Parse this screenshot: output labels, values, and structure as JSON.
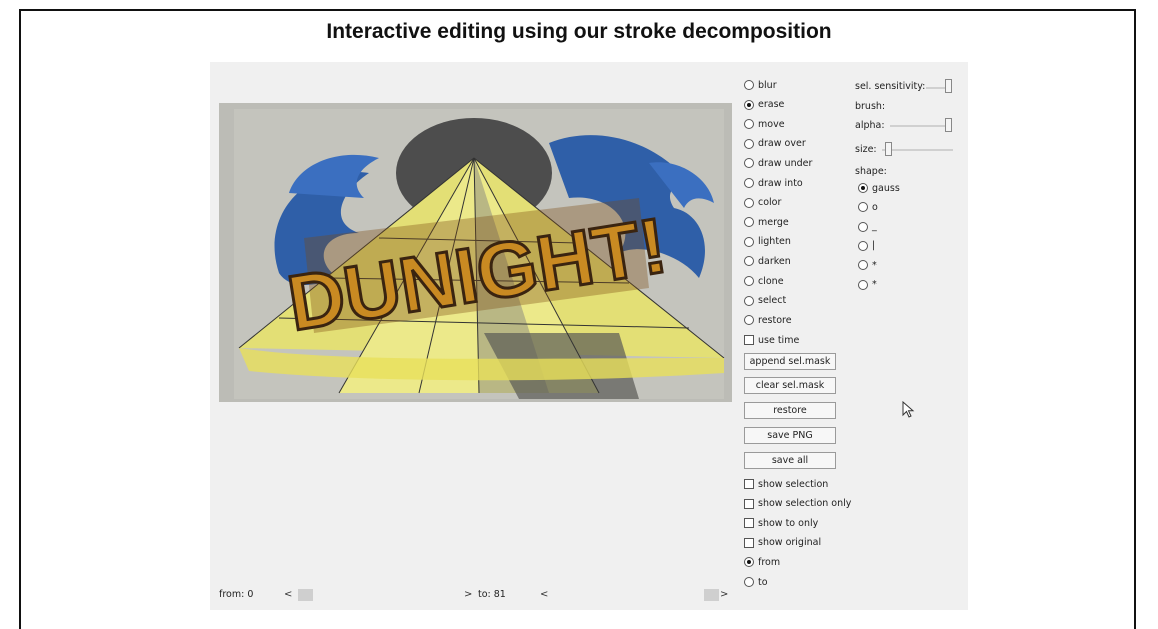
{
  "title": "Interactive editing using our stroke decomposition",
  "canvas": {
    "artwork_text": "DUNIGHT!"
  },
  "tools": [
    {
      "label": "blur",
      "selected": false
    },
    {
      "label": "erase",
      "selected": true
    },
    {
      "label": "move",
      "selected": false
    },
    {
      "label": "draw over",
      "selected": false
    },
    {
      "label": "draw under",
      "selected": false
    },
    {
      "label": "draw into",
      "selected": false
    },
    {
      "label": "color",
      "selected": false
    },
    {
      "label": "merge",
      "selected": false
    },
    {
      "label": "lighten",
      "selected": false
    },
    {
      "label": "darken",
      "selected": false
    },
    {
      "label": "clone",
      "selected": false
    },
    {
      "label": "select",
      "selected": false
    },
    {
      "label": "restore",
      "selected": false
    }
  ],
  "use_time": {
    "label": "use time",
    "checked": false
  },
  "buttons": {
    "append": "append sel.mask",
    "clear": "clear sel.mask",
    "restore": "restore",
    "save_png": "save PNG",
    "save_all": "save all"
  },
  "checks": [
    {
      "label": "show selection",
      "checked": false
    },
    {
      "label": "show selection only",
      "checked": false
    },
    {
      "label": "show to only",
      "checked": false
    },
    {
      "label": "show original",
      "checked": false
    }
  ],
  "range_mode": [
    {
      "label": "from",
      "selected": true
    },
    {
      "label": "to",
      "selected": false
    }
  ],
  "settings": {
    "sensitivity_label": "sel. sensitivity:",
    "sensitivity_value": 1.0,
    "brush_label": "brush:",
    "alpha_label": "alpha:",
    "alpha_value": 1.0,
    "size_label": "size:",
    "size_value": 0.05,
    "shape_label": "shape:",
    "shapes": [
      {
        "label": "gauss",
        "selected": true
      },
      {
        "label": "o",
        "selected": false
      },
      {
        "label": "_",
        "selected": false
      },
      {
        "label": "|",
        "selected": false
      },
      {
        "label": "*",
        "selected": false
      },
      {
        "label": "*",
        "selected": false
      }
    ]
  },
  "timeline": {
    "from_label": "from: 0",
    "to_label": "to: 81",
    "left_arrow": "<",
    "right_arrow": ">",
    "from_value": 0,
    "to_value": 81
  },
  "colors": {
    "canvas_bg": "#b9b9b4",
    "pyramid_yellow": "#e6e27a",
    "wave_blue": "#2f5fa8",
    "moon_gray": "#4a4a4a",
    "letter_orange": "#c98a22"
  }
}
